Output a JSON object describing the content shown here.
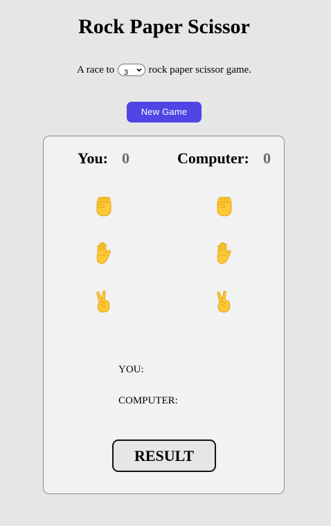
{
  "title": "Rock Paper Scissor",
  "race": {
    "prefix": "A race to",
    "selected": "3",
    "suffix": "rock paper scissor game."
  },
  "new_game_label": "New Game",
  "scoreboard": {
    "you_label": "You:",
    "you_score": "0",
    "computer_label": "Computer:",
    "computer_score": "0"
  },
  "choices": [
    {
      "name": "rock",
      "icon": "raised-fist-icon"
    },
    {
      "name": "paper",
      "icon": "raised-hand-icon"
    },
    {
      "name": "scissor",
      "icon": "victory-hand-icon"
    }
  ],
  "picks": {
    "you_label": "YOU:",
    "computer_label": "COMPUTER:"
  },
  "result_label": "RESULT",
  "colors": {
    "background": "#e6e6e6",
    "card": "#f2f2f2",
    "accent": "#4f46e5",
    "emoji": "#fdc837",
    "score": "#6b6b6b"
  }
}
